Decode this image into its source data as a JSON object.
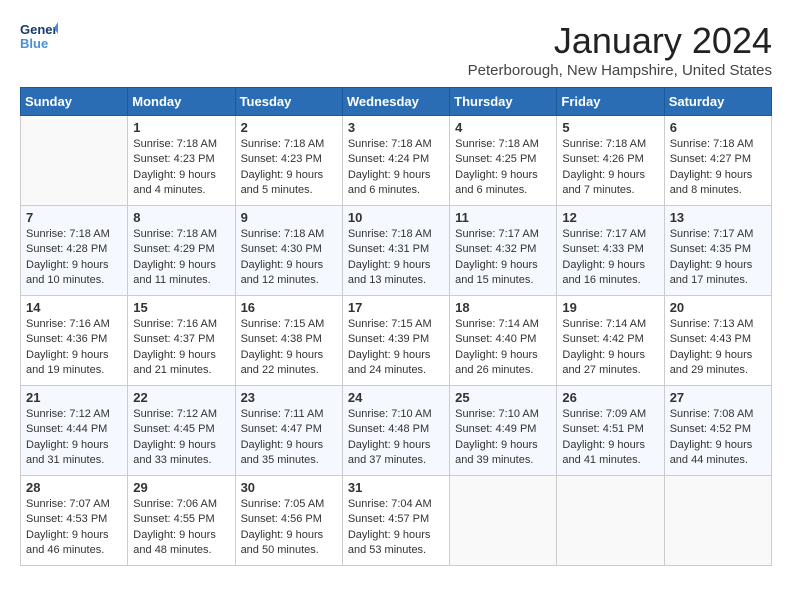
{
  "header": {
    "logo_line1": "General",
    "logo_line2": "Blue",
    "month": "January 2024",
    "location": "Peterborough, New Hampshire, United States"
  },
  "days_of_week": [
    "Sunday",
    "Monday",
    "Tuesday",
    "Wednesday",
    "Thursday",
    "Friday",
    "Saturday"
  ],
  "weeks": [
    [
      {
        "day": "",
        "content": ""
      },
      {
        "day": "1",
        "content": "Sunrise: 7:18 AM\nSunset: 4:23 PM\nDaylight: 9 hours\nand 4 minutes."
      },
      {
        "day": "2",
        "content": "Sunrise: 7:18 AM\nSunset: 4:23 PM\nDaylight: 9 hours\nand 5 minutes."
      },
      {
        "day": "3",
        "content": "Sunrise: 7:18 AM\nSunset: 4:24 PM\nDaylight: 9 hours\nand 6 minutes."
      },
      {
        "day": "4",
        "content": "Sunrise: 7:18 AM\nSunset: 4:25 PM\nDaylight: 9 hours\nand 6 minutes."
      },
      {
        "day": "5",
        "content": "Sunrise: 7:18 AM\nSunset: 4:26 PM\nDaylight: 9 hours\nand 7 minutes."
      },
      {
        "day": "6",
        "content": "Sunrise: 7:18 AM\nSunset: 4:27 PM\nDaylight: 9 hours\nand 8 minutes."
      }
    ],
    [
      {
        "day": "7",
        "content": "Sunrise: 7:18 AM\nSunset: 4:28 PM\nDaylight: 9 hours\nand 10 minutes."
      },
      {
        "day": "8",
        "content": "Sunrise: 7:18 AM\nSunset: 4:29 PM\nDaylight: 9 hours\nand 11 minutes."
      },
      {
        "day": "9",
        "content": "Sunrise: 7:18 AM\nSunset: 4:30 PM\nDaylight: 9 hours\nand 12 minutes."
      },
      {
        "day": "10",
        "content": "Sunrise: 7:18 AM\nSunset: 4:31 PM\nDaylight: 9 hours\nand 13 minutes."
      },
      {
        "day": "11",
        "content": "Sunrise: 7:17 AM\nSunset: 4:32 PM\nDaylight: 9 hours\nand 15 minutes."
      },
      {
        "day": "12",
        "content": "Sunrise: 7:17 AM\nSunset: 4:33 PM\nDaylight: 9 hours\nand 16 minutes."
      },
      {
        "day": "13",
        "content": "Sunrise: 7:17 AM\nSunset: 4:35 PM\nDaylight: 9 hours\nand 17 minutes."
      }
    ],
    [
      {
        "day": "14",
        "content": "Sunrise: 7:16 AM\nSunset: 4:36 PM\nDaylight: 9 hours\nand 19 minutes."
      },
      {
        "day": "15",
        "content": "Sunrise: 7:16 AM\nSunset: 4:37 PM\nDaylight: 9 hours\nand 21 minutes."
      },
      {
        "day": "16",
        "content": "Sunrise: 7:15 AM\nSunset: 4:38 PM\nDaylight: 9 hours\nand 22 minutes."
      },
      {
        "day": "17",
        "content": "Sunrise: 7:15 AM\nSunset: 4:39 PM\nDaylight: 9 hours\nand 24 minutes."
      },
      {
        "day": "18",
        "content": "Sunrise: 7:14 AM\nSunset: 4:40 PM\nDaylight: 9 hours\nand 26 minutes."
      },
      {
        "day": "19",
        "content": "Sunrise: 7:14 AM\nSunset: 4:42 PM\nDaylight: 9 hours\nand 27 minutes."
      },
      {
        "day": "20",
        "content": "Sunrise: 7:13 AM\nSunset: 4:43 PM\nDaylight: 9 hours\nand 29 minutes."
      }
    ],
    [
      {
        "day": "21",
        "content": "Sunrise: 7:12 AM\nSunset: 4:44 PM\nDaylight: 9 hours\nand 31 minutes."
      },
      {
        "day": "22",
        "content": "Sunrise: 7:12 AM\nSunset: 4:45 PM\nDaylight: 9 hours\nand 33 minutes."
      },
      {
        "day": "23",
        "content": "Sunrise: 7:11 AM\nSunset: 4:47 PM\nDaylight: 9 hours\nand 35 minutes."
      },
      {
        "day": "24",
        "content": "Sunrise: 7:10 AM\nSunset: 4:48 PM\nDaylight: 9 hours\nand 37 minutes."
      },
      {
        "day": "25",
        "content": "Sunrise: 7:10 AM\nSunset: 4:49 PM\nDaylight: 9 hours\nand 39 minutes."
      },
      {
        "day": "26",
        "content": "Sunrise: 7:09 AM\nSunset: 4:51 PM\nDaylight: 9 hours\nand 41 minutes."
      },
      {
        "day": "27",
        "content": "Sunrise: 7:08 AM\nSunset: 4:52 PM\nDaylight: 9 hours\nand 44 minutes."
      }
    ],
    [
      {
        "day": "28",
        "content": "Sunrise: 7:07 AM\nSunset: 4:53 PM\nDaylight: 9 hours\nand 46 minutes."
      },
      {
        "day": "29",
        "content": "Sunrise: 7:06 AM\nSunset: 4:55 PM\nDaylight: 9 hours\nand 48 minutes."
      },
      {
        "day": "30",
        "content": "Sunrise: 7:05 AM\nSunset: 4:56 PM\nDaylight: 9 hours\nand 50 minutes."
      },
      {
        "day": "31",
        "content": "Sunrise: 7:04 AM\nSunset: 4:57 PM\nDaylight: 9 hours\nand 53 minutes."
      },
      {
        "day": "",
        "content": ""
      },
      {
        "day": "",
        "content": ""
      },
      {
        "day": "",
        "content": ""
      }
    ]
  ]
}
